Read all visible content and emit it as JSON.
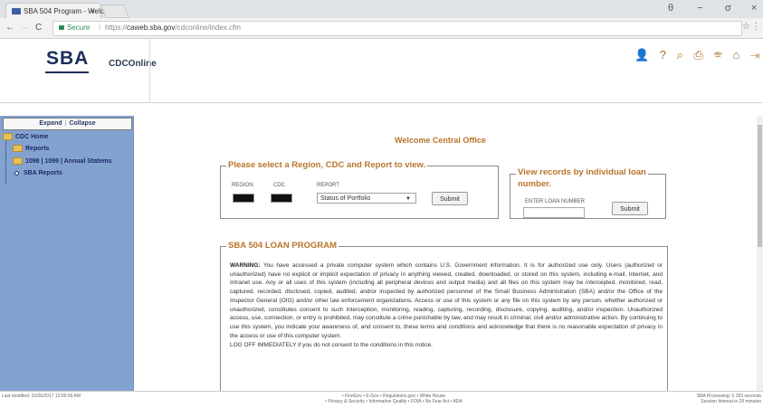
{
  "browser": {
    "tab_title": "SBA 504 Program - Welc",
    "tab_close": "×",
    "window_controls": [
      "θ",
      "−",
      "σ",
      "×"
    ],
    "secure_label": "Secure",
    "url_prefix": "https://",
    "url_domain": "caweb.sba.gov",
    "url_path": "/cdconline/index.cfm",
    "back_icon": "←",
    "forward_icon": "→",
    "reload_icon": "C",
    "star_icon": "☆",
    "menu_icon": "⋮"
  },
  "header": {
    "logo_text": "SBA",
    "app_name": "CDCOnline",
    "icons": [
      "user-icon",
      "help-icon",
      "chat-icon",
      "print-icon",
      "phone-icon",
      "home-icon",
      "logout-icon"
    ],
    "icon_glyphs": "👤 ? ⌕ ⎙ ☏ ⌂ ⇥",
    "icon_color": "#ad6a28"
  },
  "sidebar": {
    "expand_label": "Expand",
    "collapse_label": "Collapse",
    "items": [
      {
        "label": "CDC Home"
      },
      {
        "label": "Reports"
      },
      {
        "label": "1098 | 1099 | Annual Statems"
      },
      {
        "label": "SBA Reports"
      }
    ]
  },
  "main": {
    "welcome": "Welcome Central Office",
    "region_form": {
      "legend": "Please select a Region, CDC and Report to view.",
      "region_label": "REGION",
      "cdc_label": "CDC",
      "report_label": "REPORT",
      "report_selected": "Status of Portfolio",
      "submit_label": "Submit"
    },
    "loan_form": {
      "legend_line1": "View records by individual loan",
      "legend_line2": "number.",
      "input_label": "ENTER LOAN NUMBER",
      "submit_label": "Submit"
    },
    "program": {
      "legend": "SBA 504 LOAN PROGRAM",
      "warning_label": "WARNING:",
      "warning_text": "You have accessed a private computer system which contains U.S. Government information. It is for authorized use only. Users (authorized or unauthorized) have no explicit or implicit expectation of privacy in anything viewed, created, downloaded, or stored on this system, including e-mail, Internet, and Intranet use. Any or all uses of this system (including all peripheral devices and output media) and all files on this system may be intercepted, monitored, read, captured, recorded, disclosed, copied, audited, and/or inspected by authorized personnel of the Small Business Administration (SBA) and/or the Office of the Inspector General (OIG) and/or other law enforcement organizations. Access or use of this system or any file on this system by any person, whether authorized or unauthorized, constitutes consent to such interception, monitoring, reading, capturing, recording, disclosure, copying, auditing, and/or inspection. Unauthorized access, use, connection, or entry is prohibited, may constitute a crime punishable by law, and may result in criminal, civil and/or administrative action. By continuing to use this system, you indicate your awareness of, and consent to, these terms and conditions and acknowledge that there is no reasonable expectation of privacy in the access or use of this computer system.",
      "logoff_text": "LOG OFF IMMEDIATELY if you do not consent to the conditions in this notice."
    }
  },
  "footer": {
    "last_modified": "Last modified: 10/26/2017 12:00:00 AM",
    "links_line1": "• FirstGov   • E-Gov   • Regulations.gov   • White House",
    "links_line2": "• Privacy & Security   • Information Quality   • FOIA   • No Fear Act   • ADA",
    "processing": "SBA Processing: 0.183 seconds",
    "session": "Session timeout in 29 minutes"
  }
}
